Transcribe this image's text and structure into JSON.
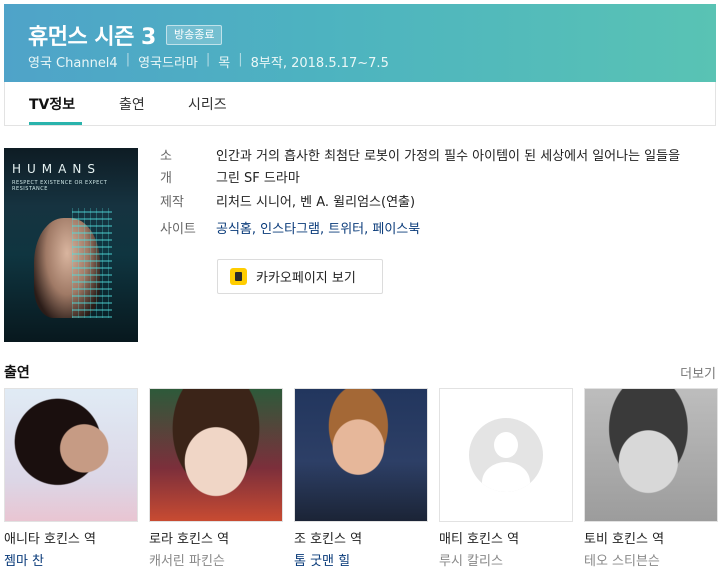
{
  "header": {
    "title": "휴먼스 시즌 3",
    "badge": "방송종료",
    "meta": [
      "영국 Channel4",
      "영국드라마",
      "목",
      "8부작, 2018.5.17~7.5"
    ]
  },
  "tabs": [
    {
      "label": "TV정보",
      "active": true
    },
    {
      "label": "출연",
      "active": false
    },
    {
      "label": "시리즈",
      "active": false
    }
  ],
  "poster": {
    "title": "HUMANS",
    "tagline": "RESPECT EXISTENCE OR EXPECT RESISTANCE"
  },
  "info": {
    "synopsis_label": "소개",
    "synopsis": "인간과 거의 흡사한 최첨단 로봇이 가정의 필수 아이템이 된 세상에서 일어나는 일들을 그린 SF 드라마",
    "production_label": "제작",
    "production": "리처드 시니어, 벤 A. 윌리엄스(연출)",
    "site_label": "사이트",
    "sites": [
      "공식홈",
      "인스타그램",
      "트위터",
      "페이스북"
    ],
    "site_sep": ", "
  },
  "kakao_button": {
    "label": "카카오페이지 보기",
    "icon": "kakaopage-icon",
    "icon_color": "#ffcd00"
  },
  "cast_section": {
    "title": "출연",
    "more": "더보기",
    "members": [
      {
        "role": "애니타 호킨스 역",
        "actor": "젬마 찬",
        "linked": true
      },
      {
        "role": "로라 호킨스 역",
        "actor": "캐서린 파킨슨",
        "linked": false
      },
      {
        "role": "조 호킨스 역",
        "actor": "톰 굿맨 힐",
        "linked": true
      },
      {
        "role": "매티 호킨스 역",
        "actor": "루시 칼리스",
        "linked": false
      },
      {
        "role": "토비 호킨스 역",
        "actor": "테오 스티븐슨",
        "linked": false
      }
    ]
  },
  "colors": {
    "accent": "#2ab3ac",
    "header_start": "#4fa3c9",
    "header_end": "#59c3b4",
    "link": "#0a3b7a"
  }
}
